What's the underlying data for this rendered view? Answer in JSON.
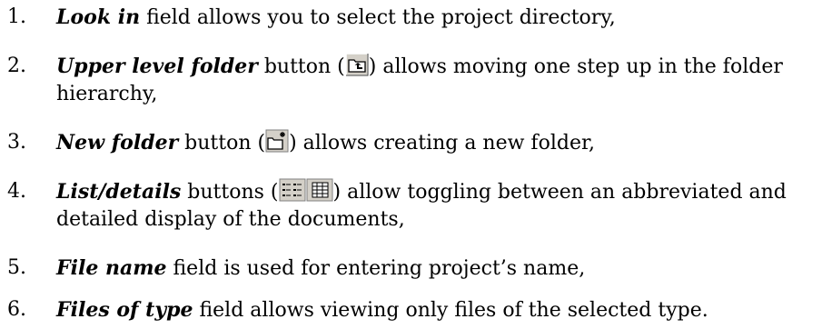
{
  "items": [
    {
      "number": "1.",
      "term": "Look in",
      "text": " field allows you to select the project directory,"
    },
    {
      "number": "2.",
      "term": "Upper level folder",
      "before_icon": " button (",
      "icon": "up-folder-icon",
      "after_icon": ") allows moving one step up in the folder",
      "line2": "hierarchy,"
    },
    {
      "number": "3.",
      "term": "New folder",
      "before_icon": " button (",
      "icon": "new-folder-icon",
      "after_icon": ") allows creating a new folder,"
    },
    {
      "number": "4.",
      "term": "List/details",
      "before_icon": " buttons (",
      "icons": [
        "list-view-icon",
        "details-view-icon"
      ],
      "after_icon": ") allow toggling between an abbreviated and",
      "line2": "detailed display of the documents,"
    },
    {
      "number": "5.",
      "term": "File name",
      "text": " field is used for entering project’s name,"
    },
    {
      "number": "6.",
      "term": "Files of type",
      "text": " field allows viewing only files of the selected type."
    }
  ]
}
